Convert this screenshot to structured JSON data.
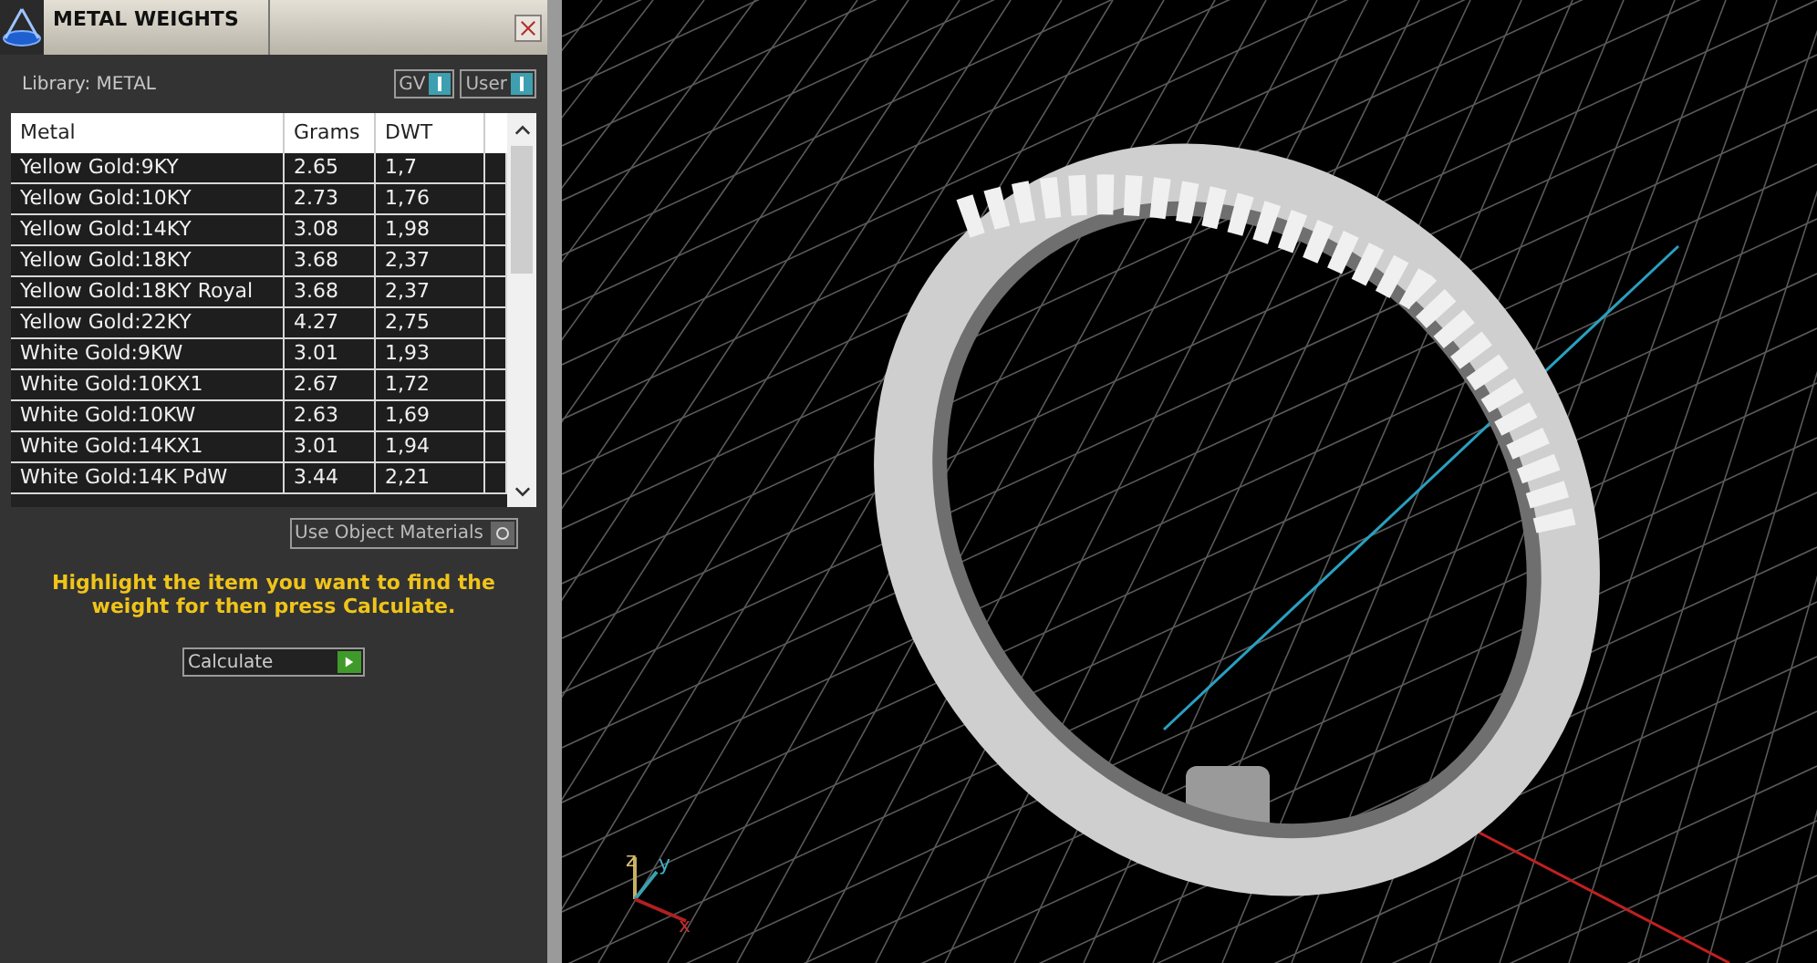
{
  "panel": {
    "title": "METAL WEIGHTS",
    "library_label": "Library: METAL",
    "toggles": [
      {
        "label": "GV",
        "on": true
      },
      {
        "label": "User",
        "on": true
      }
    ]
  },
  "table": {
    "columns": [
      "Metal",
      "Grams",
      "DWT"
    ],
    "rows": [
      [
        "Yellow Gold:9KY",
        "2.65",
        "1,7"
      ],
      [
        "Yellow Gold:10KY",
        "2.73",
        "1,76"
      ],
      [
        "Yellow Gold:14KY",
        "3.08",
        "1,98"
      ],
      [
        "Yellow Gold:18KY",
        "3.68",
        "2,37"
      ],
      [
        "Yellow Gold:18KY Royal",
        "3.68",
        "2,37"
      ],
      [
        "Yellow Gold:22KY",
        "4.27",
        "2,75"
      ],
      [
        "White Gold:9KW",
        "3.01",
        "1,93"
      ],
      [
        "White Gold:10KX1",
        "2.67",
        "1,72"
      ],
      [
        "White Gold:10KW",
        "2.63",
        "1,69"
      ],
      [
        "White Gold:14KX1",
        "3.01",
        "1,94"
      ],
      [
        "White Gold:14K PdW",
        "3.44",
        "2,21"
      ]
    ]
  },
  "use_object_materials": {
    "label": "Use Object Materials",
    "on": false
  },
  "instruction": "Highlight the item you want to find the weight for then press Calculate.",
  "calculate_button": "Calculate",
  "viewport": {
    "axes": [
      "z",
      "y",
      "x"
    ]
  }
}
